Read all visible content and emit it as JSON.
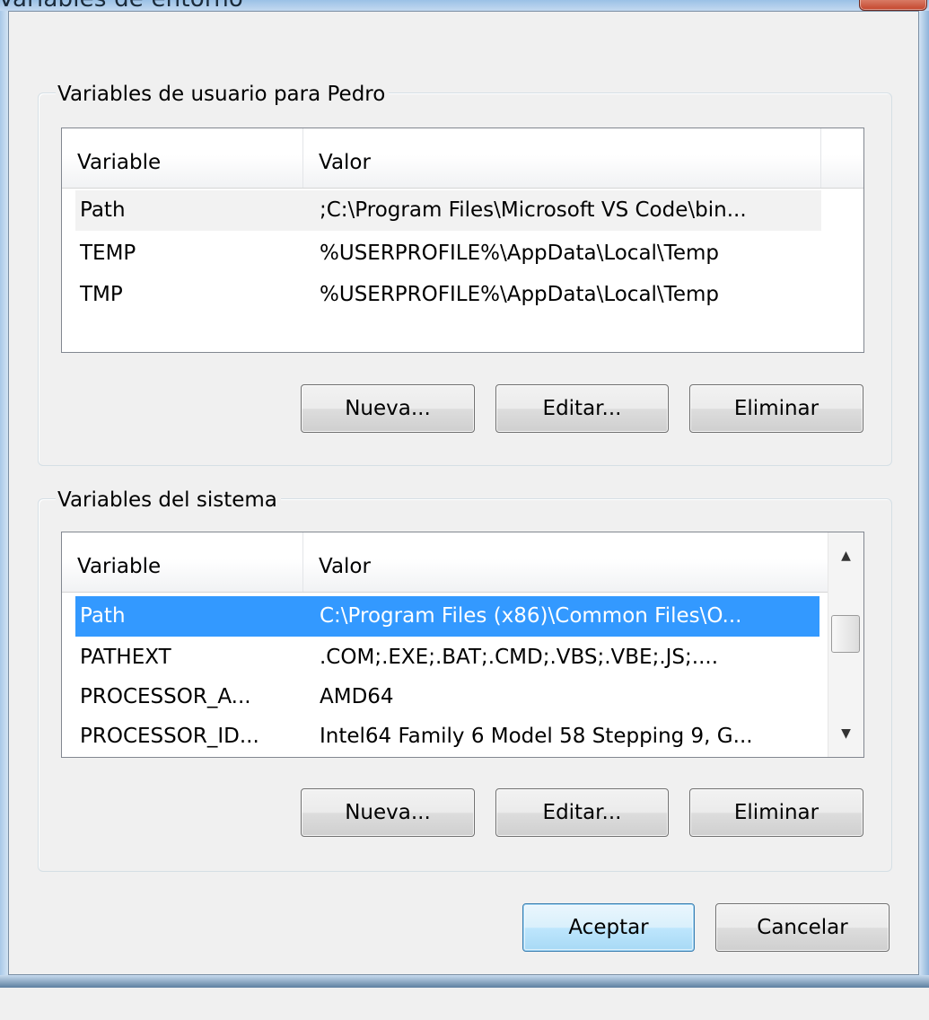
{
  "window": {
    "title": "Variables de entorno"
  },
  "user_group": {
    "legend": "Variables de usuario para Pedro",
    "columns": [
      "Variable",
      "Valor"
    ],
    "rows": [
      {
        "variable": "Path",
        "value": ";C:\\Program Files\\Microsoft VS Code\\bin..."
      },
      {
        "variable": "TEMP",
        "value": "%USERPROFILE%\\AppData\\Local\\Temp"
      },
      {
        "variable": "TMP",
        "value": "%USERPROFILE%\\AppData\\Local\\Temp"
      }
    ],
    "buttons": {
      "new": "Nueva...",
      "edit": "Editar...",
      "delete": "Eliminar"
    }
  },
  "system_group": {
    "legend": "Variables del sistema",
    "columns": [
      "Variable",
      "Valor"
    ],
    "rows": [
      {
        "variable": "Path",
        "value": "C:\\Program Files (x86)\\Common Files\\O..."
      },
      {
        "variable": "PATHEXT",
        "value": ".COM;.EXE;.BAT;.CMD;.VBS;.VBE;.JS;...."
      },
      {
        "variable": "PROCESSOR_A...",
        "value": "AMD64"
      },
      {
        "variable": "PROCESSOR_ID...",
        "value": "Intel64 Family 6 Model 58 Stepping 9, G..."
      }
    ],
    "selected_row": "Path",
    "buttons": {
      "new": "Nueva...",
      "edit": "Editar...",
      "delete": "Eliminar"
    },
    "scrollbar": {
      "up_icon": "▲",
      "down_icon": "▼"
    }
  },
  "dialog_buttons": {
    "ok": "Aceptar",
    "cancel": "Cancelar"
  },
  "colors": {
    "selection": "#3399ff",
    "window_bg": "#f0f0f0",
    "close_button": "#c4452c"
  }
}
